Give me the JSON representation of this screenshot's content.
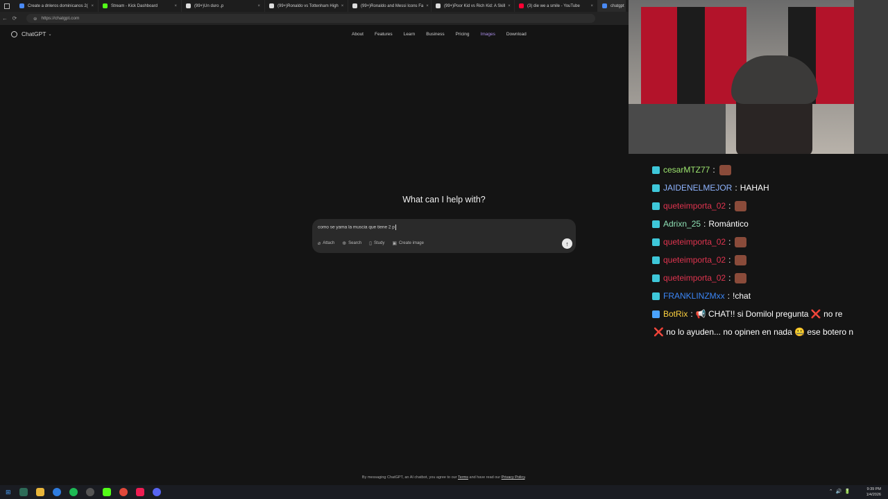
{
  "browser": {
    "tabs": [
      {
        "title": "Create a dnleros dominicanos 2(",
        "color": "#4a8af4"
      },
      {
        "title": "Stream - Kick Dashboard",
        "color": "#53fc18"
      },
      {
        "title": "(99+)Un duro ,p",
        "color": "#dddddd"
      },
      {
        "title": "(99+)Ronaldo vs Tottenham High",
        "color": "#dddddd"
      },
      {
        "title": "(99+)Ronaldo and Messi Icons Fa",
        "color": "#dddddd"
      },
      {
        "title": "(99+)Poor Kid vs Rich Kid: A Skill",
        "color": "#dddddd"
      },
      {
        "title": "(3) die we a smile - YouTube",
        "color": "#ff0033"
      },
      {
        "title": "chatgpt - S",
        "color": "#4a8af4"
      }
    ],
    "url": "https://chatgpt.com"
  },
  "chatgpt": {
    "brand": "ChatGPT",
    "nav": [
      "About",
      "Features",
      "Learn",
      "Business",
      "Pricing",
      "Images",
      "Download"
    ],
    "heading": "What can I help with?",
    "input_value": "como se yama la muscia que tiene 2 p",
    "tools": [
      {
        "icon": "paperclip-icon",
        "label": "Attach"
      },
      {
        "icon": "globe-icon",
        "label": "Search"
      },
      {
        "icon": "book-icon",
        "label": "Study"
      },
      {
        "icon": "image-icon",
        "label": "Create image"
      }
    ],
    "footer_prefix": "By messaging ChatGPT, an AI chatbot, you agree to our",
    "footer_terms": "Terms",
    "footer_mid": "and have read our",
    "footer_privacy": "Privacy Policy",
    "footer_end": "."
  },
  "chat": {
    "messages": [
      {
        "user": "cesarMTZ77",
        "color": "#9fe870",
        "body": "",
        "emote": true
      },
      {
        "user": "JAIDENELMEJOR",
        "color": "#8fb4ff",
        "body": "HAHAH",
        "emote": false
      },
      {
        "user": "queteimporta_02",
        "color": "#e0344f",
        "body": "",
        "emote": true
      },
      {
        "user": "Adrixn_25",
        "color": "#8ee0b4",
        "body": "Romántico",
        "emote": false
      },
      {
        "user": "queteimporta_02",
        "color": "#e0344f",
        "body": "",
        "emote": true
      },
      {
        "user": "queteimporta_02",
        "color": "#e0344f",
        "body": "",
        "emote": true
      },
      {
        "user": "queteimporta_02",
        "color": "#e0344f",
        "body": "",
        "emote": true
      },
      {
        "user": "FRANKLINZMxx",
        "color": "#3b86f7",
        "body": "!chat",
        "emote": false
      },
      {
        "user": "BotRix",
        "color": "#ffd23f",
        "body": "📢 CHAT!! si Domilol pregunta ❌ no re",
        "emote": false
      },
      {
        "user": "",
        "color": "#ffffff",
        "body": "❌ no lo ayuden... no opinen en nada 🤐 ese botero n",
        "emote": false
      }
    ]
  },
  "taskbar": {
    "time": "9:39 PM",
    "date": "1/4/2026"
  }
}
